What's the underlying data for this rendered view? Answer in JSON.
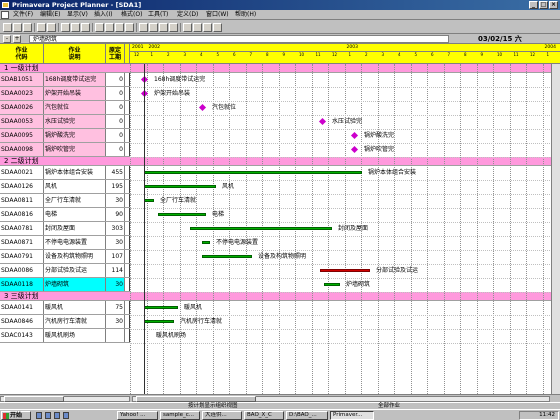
{
  "window": {
    "title": "Primavera Project Planner - [SDA1]"
  },
  "menu": [
    "文件(F)",
    "编辑(E)",
    "显示(V)",
    "插入(I)",
    "格式(O)",
    "工具(T)",
    "定义(D)",
    "窗口(W)",
    "帮助(H)"
  ],
  "editbar": {
    "minus": "-",
    "plus": "+",
    "value": "炉墙砌筑",
    "date": "03/02/15 六"
  },
  "headers": {
    "code": "作业\n代码",
    "desc": "作业\n说明",
    "dur": "原定\n工期"
  },
  "timeline_header": {
    "years": [
      "2001",
      "2002",
      "2003",
      "2004"
    ],
    "months": [
      "12",
      "1",
      "2",
      "3",
      "4",
      "5",
      "6",
      "7",
      "8",
      "9",
      "10",
      "11",
      "12",
      "1",
      "2",
      "3",
      "4",
      "5",
      "6",
      "7",
      "8",
      "9",
      "10",
      "11",
      "12",
      "1"
    ]
  },
  "groups": [
    {
      "label": "一级计划"
    },
    {
      "label": "二级计划"
    },
    {
      "label": "三级计划"
    }
  ],
  "rows": [
    {
      "code": "SDAB1051",
      "desc": "168h调度带试运完",
      "dur": "0",
      "kind": "milestone",
      "label": "168h调度带试运完"
    },
    {
      "code": "SDAA0023",
      "desc": "炉架开始吊装",
      "dur": "0",
      "kind": "milestone",
      "label": "炉架开始吊装"
    },
    {
      "code": "SDAA0026",
      "desc": "汽包就位",
      "dur": "0",
      "kind": "milestone",
      "label": "汽包就位"
    },
    {
      "code": "SDAA0053",
      "desc": "水压试验完",
      "dur": "0",
      "kind": "milestone",
      "label": "水压试验完"
    },
    {
      "code": "SDAA0095",
      "desc": "锅炉酸洗完",
      "dur": "0",
      "kind": "milestone",
      "label": "锅炉酸洗完"
    },
    {
      "code": "SDAA0098",
      "desc": "锅炉吹管完",
      "dur": "0",
      "kind": "milestone",
      "label": "锅炉吹管完"
    },
    {
      "code": "SDAA0021",
      "desc": "锅炉本体组合安装",
      "dur": "455",
      "kind": "bar",
      "label": "锅炉本体组合安装"
    },
    {
      "code": "SDAA0126",
      "desc": "风机",
      "dur": "195",
      "kind": "bar",
      "label": "风机"
    },
    {
      "code": "SDAA0811",
      "desc": "全厂行车清就",
      "dur": "30",
      "kind": "bar",
      "label": "全厂行车清就"
    },
    {
      "code": "SDAA0816",
      "desc": "电梯",
      "dur": "90",
      "kind": "bar",
      "label": "电梯"
    },
    {
      "code": "SDAA0781",
      "desc": "封闭及屋面",
      "dur": "303",
      "kind": "bar",
      "label": "封闭及屋面"
    },
    {
      "code": "SDAA0871",
      "desc": "不停电电源装置",
      "dur": "30",
      "kind": "bar",
      "label": "不停电电源装置"
    },
    {
      "code": "SDAA0791",
      "desc": "设备及构筑物照明",
      "dur": "107",
      "kind": "bar",
      "label": "设备及构筑物照明"
    },
    {
      "code": "SDAA0086",
      "desc": "分部试验及试运",
      "dur": "114",
      "kind": "redbar",
      "label": "分部试验及试运"
    },
    {
      "code": "SDAA0118",
      "desc": "炉墙砌筑",
      "dur": "30",
      "kind": "bar",
      "label": "炉墙砌筑"
    },
    {
      "code": "SDAA0141",
      "desc": "暖风机",
      "dur": "75",
      "kind": "bar",
      "label": "暖风机"
    },
    {
      "code": "SDAA0846",
      "desc": "汽机房行车清就",
      "dur": "30",
      "kind": "bar",
      "label": "汽机房行车清就"
    },
    {
      "code": "SDAC0143",
      "desc": "暖风机刷场",
      "dur": "",
      "kind": "bar",
      "label": "暖风机刷场"
    }
  ],
  "status": {
    "left": "按计划显示组织视图",
    "right": "全部作业"
  },
  "taskbar": {
    "start": "开始",
    "tasks": [
      "Yahoo! ...",
      "sample_c...",
      "大连供...",
      "BAO_X_C",
      "D:\\BAO_...",
      "Primaver..."
    ],
    "clock": "11:42"
  },
  "colors": {
    "bar": "#00b000",
    "critical_bar": "#d00000",
    "milestone": "#cc00cc",
    "group_band": "#ff99dd",
    "header": "#ffff00",
    "selected": "#00ffff"
  }
}
